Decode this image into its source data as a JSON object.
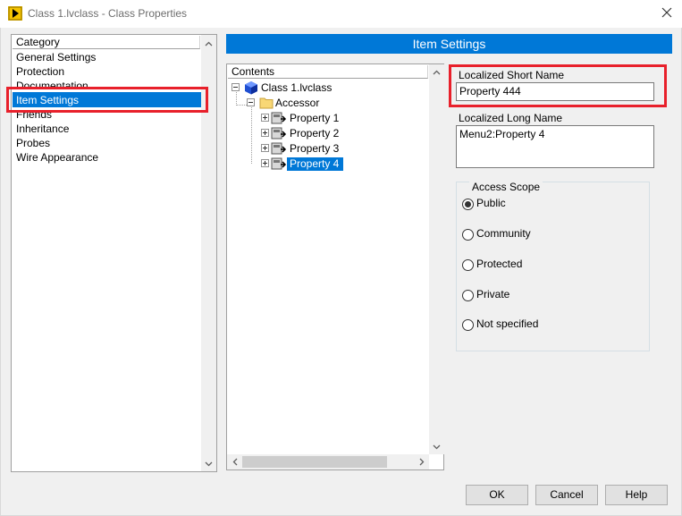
{
  "window": {
    "title": "Class 1.lvclass - Class Properties",
    "close_glyph": "✕"
  },
  "category": {
    "header": "Category",
    "items": [
      {
        "label": "General Settings"
      },
      {
        "label": "Protection"
      },
      {
        "label": "Documentation"
      },
      {
        "label": "Item Settings",
        "selected": true
      },
      {
        "label": "Friends"
      },
      {
        "label": "Inheritance"
      },
      {
        "label": "Probes"
      },
      {
        "label": "Wire Appearance"
      }
    ]
  },
  "item_settings": {
    "header": "Item Settings",
    "contents_header": "Contents",
    "tree": {
      "root": "Class 1.lvclass",
      "folder": "Accessor",
      "properties": [
        "Property 1",
        "Property 2",
        "Property 3",
        "Property 4"
      ],
      "selected": "Property 4"
    },
    "short_name_label": "Localized Short Name",
    "short_name_value": "Property 444",
    "long_name_label": "Localized Long Name",
    "long_name_value": "Menu2:Property 4",
    "access_scope": {
      "title": "Access Scope",
      "options": [
        "Public",
        "Community",
        "Protected",
        "Private",
        "Not specified"
      ],
      "selected": "Public"
    }
  },
  "buttons": {
    "ok": "OK",
    "cancel": "Cancel",
    "help": "Help"
  },
  "colors": {
    "selection": "#0078d7",
    "highlight_box": "#e8202b",
    "app_icon": "#f5c400"
  },
  "icons": [
    "labview-app-icon",
    "close-icon",
    "class-cube-icon",
    "folder-icon",
    "property-node-icon",
    "scroll-arrow-icon"
  ]
}
